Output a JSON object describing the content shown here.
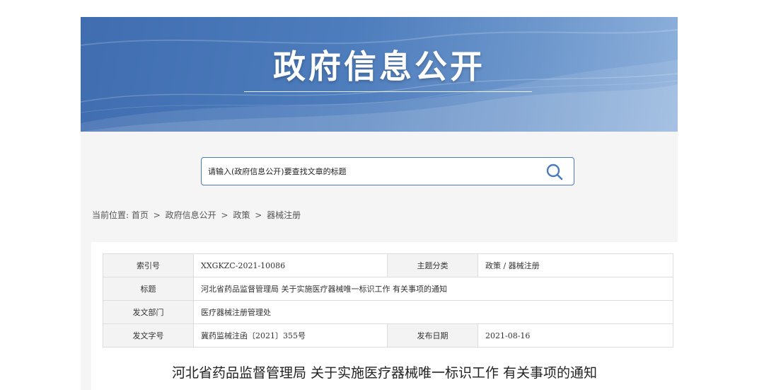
{
  "banner": {
    "title": "政府信息公开"
  },
  "search": {
    "placeholder": "请输入(政府信息公开)要查找文章的标题",
    "icon": "search-icon"
  },
  "breadcrumb": {
    "label": "当前位置:",
    "items": [
      "首页",
      "政府信息公开",
      "政策",
      "器械注册"
    ],
    "separator": ">"
  },
  "meta": {
    "index_label": "索引号",
    "index_value": "XXGKZC-2021-10086",
    "topic_label": "主题分类",
    "topic_value": "政策 / 器械注册",
    "title_label": "标题",
    "title_value": "河北省药品监督管理局 关于实施医疗器械唯一标识工作 有关事项的通知",
    "dept_label": "发文部门",
    "dept_value": "医疗器械注册管理处",
    "docno_label": "发文字号",
    "docno_value": "冀药监械注函〔2021〕355号",
    "date_label": "发布日期",
    "date_value": "2021-08-16"
  },
  "article": {
    "title": "河北省药品监督管理局 关于实施医疗器械唯一标识工作 有关事项的通知"
  },
  "colors": {
    "accent": "#4c7bbb",
    "banner": "#4e7dbd",
    "label_bg": "#f3f3f3"
  }
}
